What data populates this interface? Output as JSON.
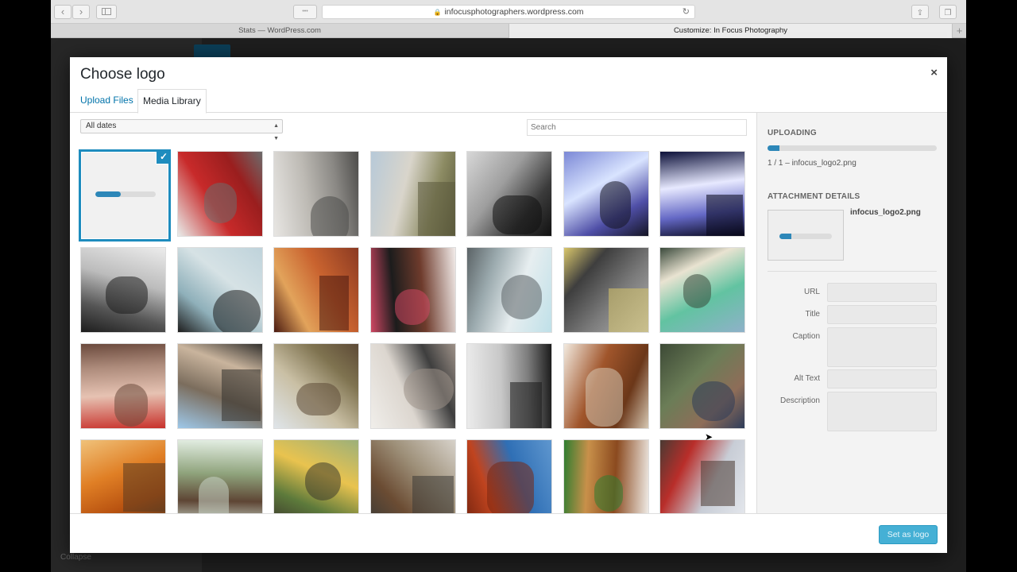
{
  "browser": {
    "url": "infocusphotographers.wordpress.com",
    "tabs": [
      {
        "label": "Stats — WordPress.com",
        "active": false
      },
      {
        "label": "Customize: In Focus Photography",
        "active": true
      }
    ],
    "nav_back": "‹",
    "nav_forward": "›",
    "password_btn": "•••",
    "new_tab": "+"
  },
  "background_page": {
    "collapse_label": "Collapse"
  },
  "modal": {
    "title": "Choose logo",
    "close_glyph": "×",
    "router_tabs": [
      {
        "label": "Upload Files",
        "active": false
      },
      {
        "label": "Media Library",
        "active": true
      }
    ],
    "filter": {
      "value": "All dates"
    },
    "search": {
      "placeholder": "Search"
    },
    "grid": {
      "items": [
        {
          "name": "uploading-logo",
          "type": "upload",
          "progress": 0.42,
          "selected": true
        },
        {
          "name": "red-vintage-car",
          "colors": [
            "#e9ecea",
            "#c82a2a",
            "#9a1e1e",
            "#6c6c6c"
          ]
        },
        {
          "name": "retro-tv",
          "colors": [
            "#e8e6e3",
            "#bdbab4",
            "#8a8884",
            "#4d4c4a"
          ]
        },
        {
          "name": "wedding-gazebo",
          "colors": [
            "#b7c9d8",
            "#d9d5cb",
            "#8c8b63",
            "#5b5a3c"
          ]
        },
        {
          "name": "silhouette-smoke",
          "colors": [
            "#d7d7d7",
            "#9e9e9e",
            "#3b3b3b",
            "#111111"
          ]
        },
        {
          "name": "concert-lights",
          "colors": [
            "#7b88d6",
            "#d9e4ff",
            "#4f4fa7",
            "#151525"
          ]
        },
        {
          "name": "neon-letters-crowd",
          "colors": [
            "#0b0f38",
            "#e7e9ff",
            "#6468c5",
            "#07071a"
          ]
        },
        {
          "name": "wedding-couple",
          "colors": [
            "#ececec",
            "#bcbcbc",
            "#565656",
            "#1d1d1d"
          ]
        },
        {
          "name": "eyeglasses",
          "colors": [
            "#bfd3db",
            "#d6e2e5",
            "#8fb0ba",
            "#1e1e1e"
          ]
        },
        {
          "name": "bacon",
          "colors": [
            "#8b3a22",
            "#c9632f",
            "#e2a35b",
            "#4a1a10"
          ]
        },
        {
          "name": "chocolate-miles",
          "colors": [
            "#f2ecea",
            "#6e3b2c",
            "#1c1c1c",
            "#cf4763"
          ]
        },
        {
          "name": "laptop-desk",
          "colors": [
            "#bfe0e8",
            "#e7eef0",
            "#9aa9ad",
            "#5b6366"
          ]
        },
        {
          "name": "train-tunnel",
          "colors": [
            "#b7b7b7",
            "#7a7a7a",
            "#3e3e3e",
            "#d9c76c"
          ]
        },
        {
          "name": "vw-bus",
          "colors": [
            "#8fb1c9",
            "#62c3a1",
            "#e9e3d1",
            "#3b4a3c"
          ]
        },
        {
          "name": "old-woman",
          "colors": [
            "#c8312b",
            "#e6c2b2",
            "#ad8b7b",
            "#6b4a3d"
          ]
        },
        {
          "name": "railway-woman",
          "colors": [
            "#9ec8e9",
            "#7b6d5d",
            "#c9b49d",
            "#33312e"
          ]
        },
        {
          "name": "house-flag",
          "colors": [
            "#dfe5ea",
            "#c9bfa4",
            "#7f7350",
            "#5d4a36"
          ]
        },
        {
          "name": "workspace-table",
          "colors": [
            "#f0eeea",
            "#dcd6cf",
            "#3e3e3e",
            "#9d9188"
          ]
        },
        {
          "name": "dancer",
          "colors": [
            "#ebebeb",
            "#c8c8c8",
            "#7d7d7d",
            "#1b1b1b"
          ]
        },
        {
          "name": "leather-bag",
          "colors": [
            "#f2eadf",
            "#a0552b",
            "#6b3719",
            "#d6c7b2"
          ]
        },
        {
          "name": "woman-portrait-leaves",
          "colors": [
            "#3d4a36",
            "#6b7d57",
            "#8e6d58",
            "#2e3c5a"
          ]
        },
        {
          "name": "autumn-tree",
          "colors": [
            "#f0c27a",
            "#e07f25",
            "#b85210",
            "#5a3b20"
          ]
        },
        {
          "name": "cafe-window",
          "colors": [
            "#e4efe4",
            "#8fa37c",
            "#5e4534",
            "#c6d2c4"
          ]
        },
        {
          "name": "forest-cabin",
          "colors": [
            "#9cb07a",
            "#e9c34f",
            "#5d7a3b",
            "#3c3a2c"
          ]
        },
        {
          "name": "misty-road",
          "colors": [
            "#d7d2ca",
            "#9d8f78",
            "#6b4c33",
            "#3d3b36"
          ]
        },
        {
          "name": "red-leaves-sky",
          "colors": [
            "#5f97cf",
            "#2f6fb5",
            "#c0441f",
            "#7a2610"
          ]
        },
        {
          "name": "burger-tea",
          "colors": [
            "#f0ece7",
            "#8b4a1f",
            "#c8904a",
            "#2f7d30"
          ]
        },
        {
          "name": "man-plaid-shirt",
          "colors": [
            "#e6e9ee",
            "#c8cdd6",
            "#b92e2a",
            "#4a3a33"
          ]
        }
      ]
    },
    "sidebar": {
      "uploading_label": "UPLOADING",
      "upload_progress": 0.07,
      "upload_file_line": "1 / 1  –  infocus_logo2.png",
      "attachment_label": "ATTACHMENT DETAILS",
      "attachment_filename": "infocus_logo2.png",
      "attachment_progress": 0.22,
      "fields": [
        {
          "label": "URL",
          "multiline": false
        },
        {
          "label": "Title",
          "multiline": false
        },
        {
          "label": "Caption",
          "multiline": true
        },
        {
          "label": "Alt Text",
          "multiline": false
        },
        {
          "label": "Description",
          "multiline": true
        }
      ]
    },
    "primary_button": "Set as logo"
  },
  "accent_color": "#1e8cbe"
}
